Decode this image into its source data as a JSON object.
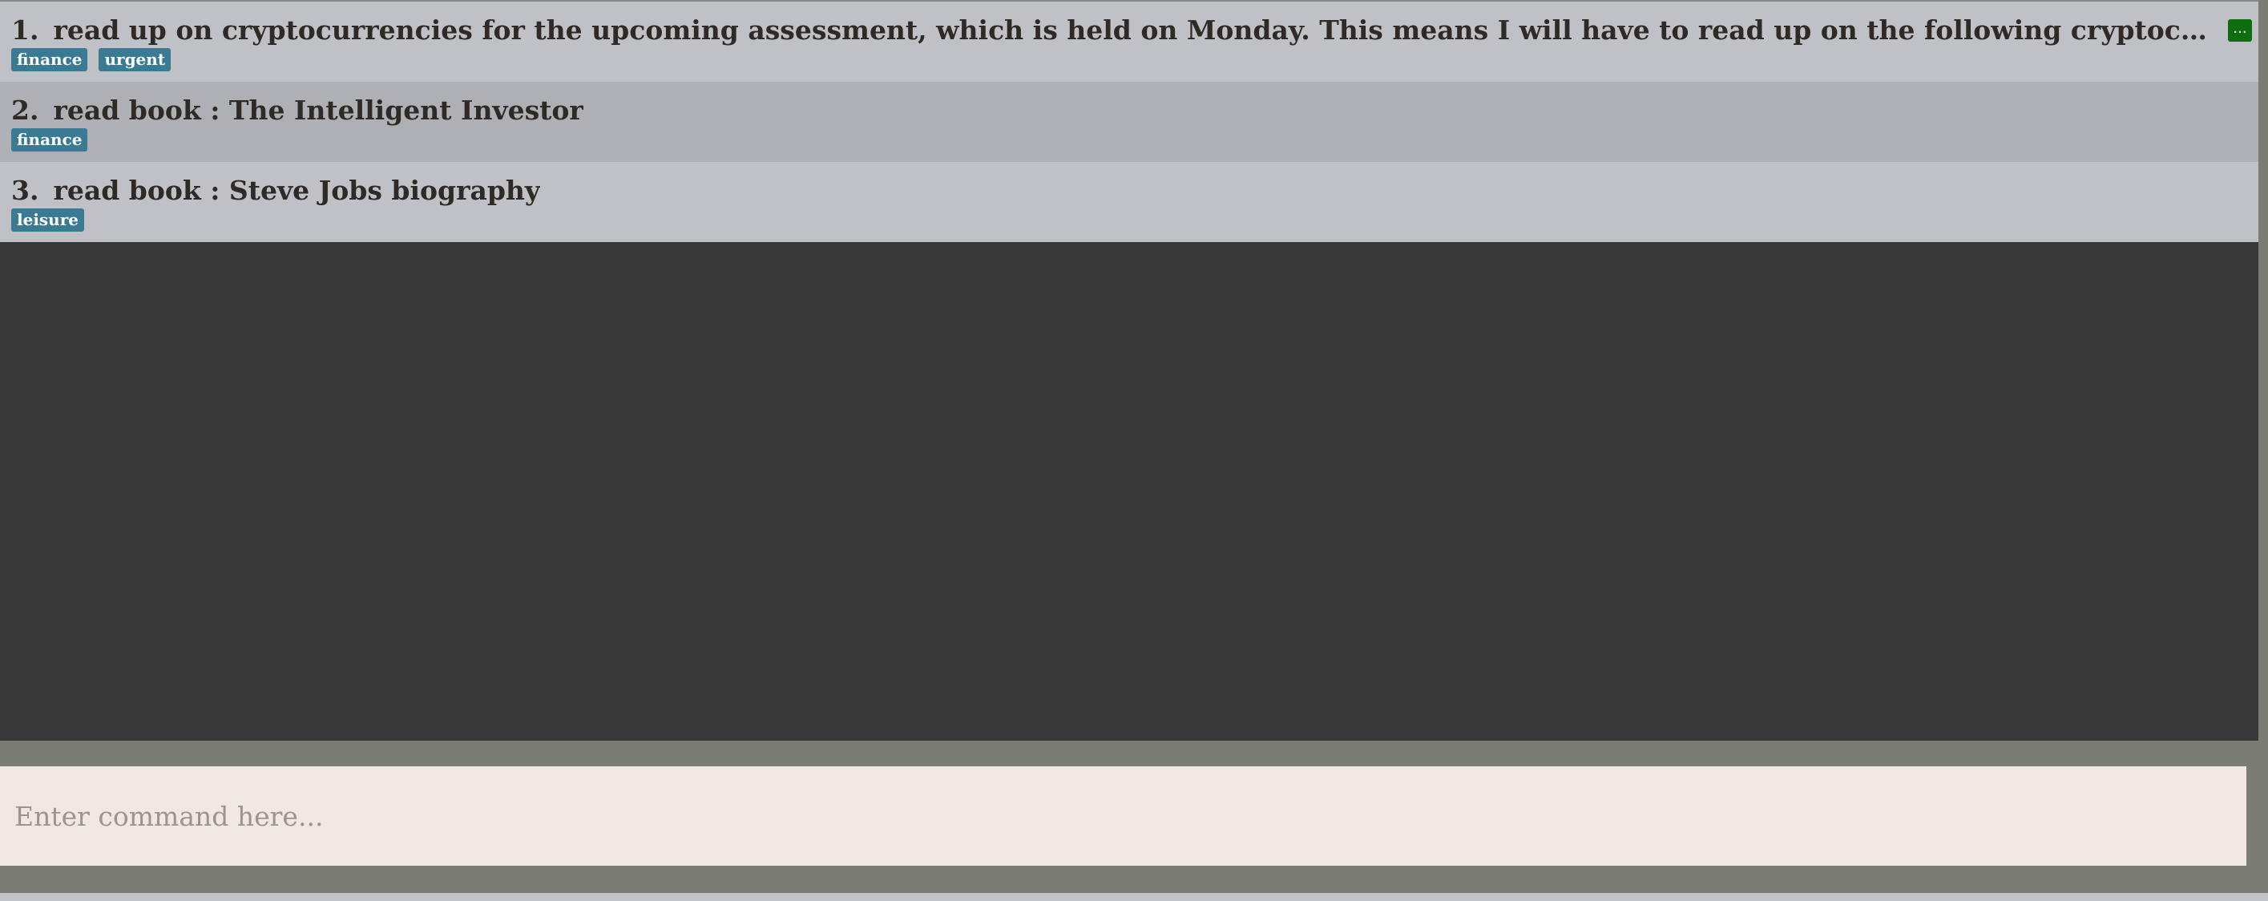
{
  "tasks": [
    {
      "index": "1.",
      "title": "read up on cryptocurrencies for the upcoming assessment, which is held on Monday. This means I will have to read up on the following cryptocurrencies topics, which ar...",
      "tags": [
        "finance",
        "urgent"
      ],
      "more_label": "..."
    },
    {
      "index": "2.",
      "title": "read book : The Intelligent Investor",
      "tags": [
        "finance"
      ]
    },
    {
      "index": "3.",
      "title": "read book : Steve Jobs biography",
      "tags": [
        "leisure"
      ]
    }
  ],
  "command": {
    "placeholder": "Enter command here...",
    "value": ""
  },
  "colors": {
    "tag": "#3b7a93",
    "more_button": "#0d6e0d",
    "list_bg": "#383838",
    "row_light": "#c0c1c6",
    "row_dark": "#afb0b5",
    "command_bg": "#f2e8e2",
    "frame": "#7b7d75"
  }
}
